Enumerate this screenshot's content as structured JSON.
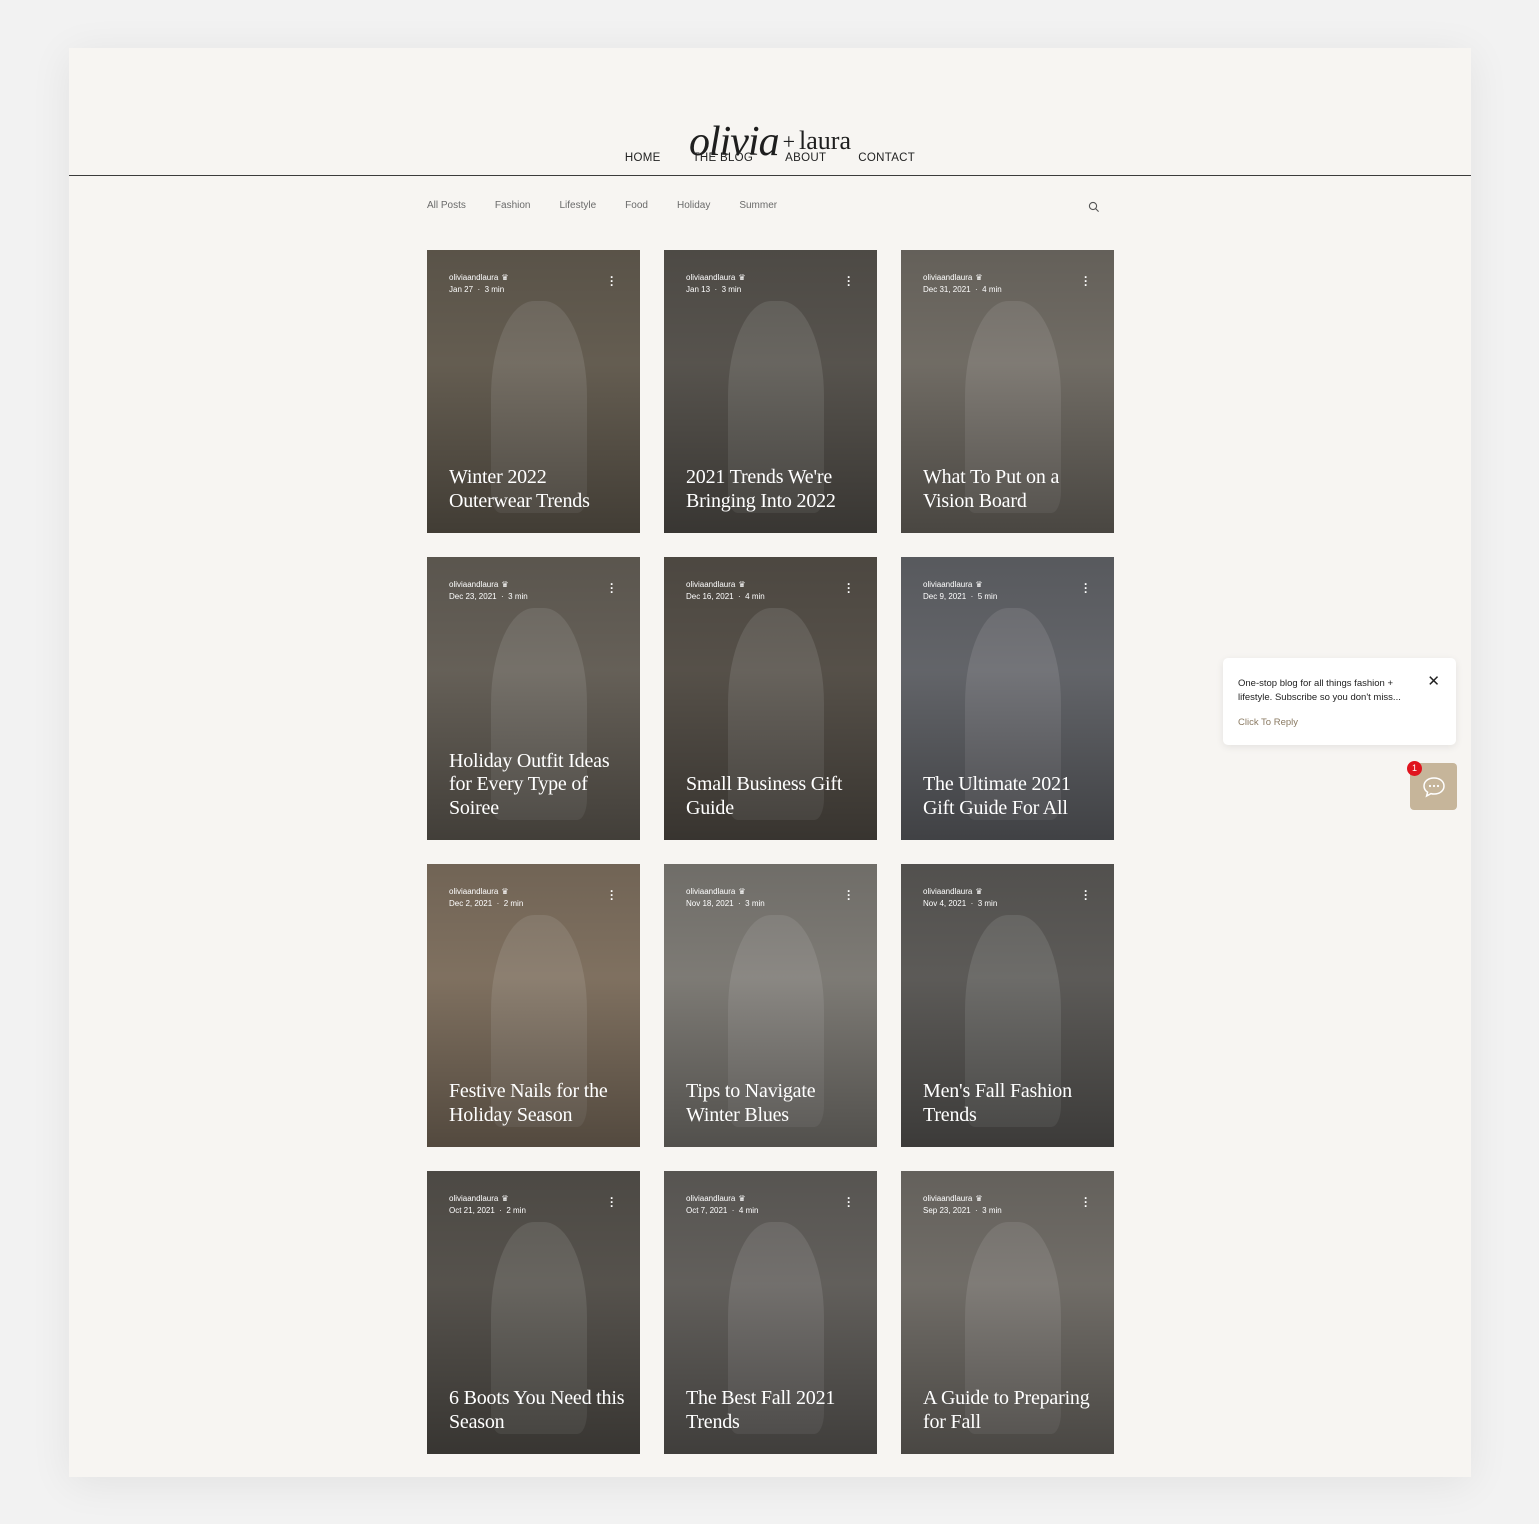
{
  "brand": {
    "script": "olivia",
    "plus": "+",
    "name": "laura"
  },
  "nav": {
    "home": "HOME",
    "blog": "THE BLOG",
    "about": "ABOUT",
    "contact": "CONTACT"
  },
  "categories": [
    "All Posts",
    "Fashion",
    "Lifestyle",
    "Food",
    "Holiday",
    "Summer"
  ],
  "search_icon": "search-icon",
  "posts": [
    {
      "author": "oliviaandlaura",
      "date": "Jan 27",
      "read": "3 min",
      "title": "Winter 2022 Outerwear Trends",
      "bg": "#6d6558"
    },
    {
      "author": "oliviaandlaura",
      "date": "Jan 13",
      "read": "3 min",
      "title": "2021 Trends We're Bringing Into 2022",
      "bg": "#5e5a54"
    },
    {
      "author": "oliviaandlaura",
      "date": "Dec 31, 2021",
      "read": "4 min",
      "title": "What To Put on a Vision Board",
      "bg": "#7a756d"
    },
    {
      "author": "oliviaandlaura",
      "date": "Dec 23, 2021",
      "read": "3 min",
      "title": "Holiday Outfit Ideas for Every Type of Soiree",
      "bg": "#6e685f"
    },
    {
      "author": "oliviaandlaura",
      "date": "Dec 16, 2021",
      "read": "4 min",
      "title": "Small Business Gift Guide",
      "bg": "#5d574f"
    },
    {
      "author": "oliviaandlaura",
      "date": "Dec 9, 2021",
      "read": "5 min",
      "title": "The Ultimate 2021 Gift Guide For All",
      "bg": "#6b6d72"
    },
    {
      "author": "oliviaandlaura",
      "date": "Dec 2, 2021",
      "read": "2 min",
      "title": "Festive Nails for the Holiday Season",
      "bg": "#8a7a68"
    },
    {
      "author": "oliviaandlaura",
      "date": "Nov 18, 2021",
      "read": "3 min",
      "title": "Tips to Navigate Winter Blues",
      "bg": "#88857f"
    },
    {
      "author": "oliviaandlaura",
      "date": "Nov 4, 2021",
      "read": "3 min",
      "title": "Men's Fall Fashion Trends",
      "bg": "#64625f"
    },
    {
      "author": "oliviaandlaura",
      "date": "Oct 21, 2021",
      "read": "2 min",
      "title": "6 Boots You Need this Season",
      "bg": "#5d5953"
    },
    {
      "author": "oliviaandlaura",
      "date": "Oct 7, 2021",
      "read": "4 min",
      "title": "The Best Fall 2021 Trends",
      "bg": "#6a6763"
    },
    {
      "author": "oliviaandlaura",
      "date": "Sep 23, 2021",
      "read": "3 min",
      "title": "A Guide to Preparing for Fall",
      "bg": "#7a7670"
    }
  ],
  "chat": {
    "message": "One-stop blog for all things fashion + lifestyle. Subscribe so you don't miss...",
    "reply": "Click To Reply",
    "close": "✕",
    "badge": "1",
    "accent": "#c6b59a"
  }
}
